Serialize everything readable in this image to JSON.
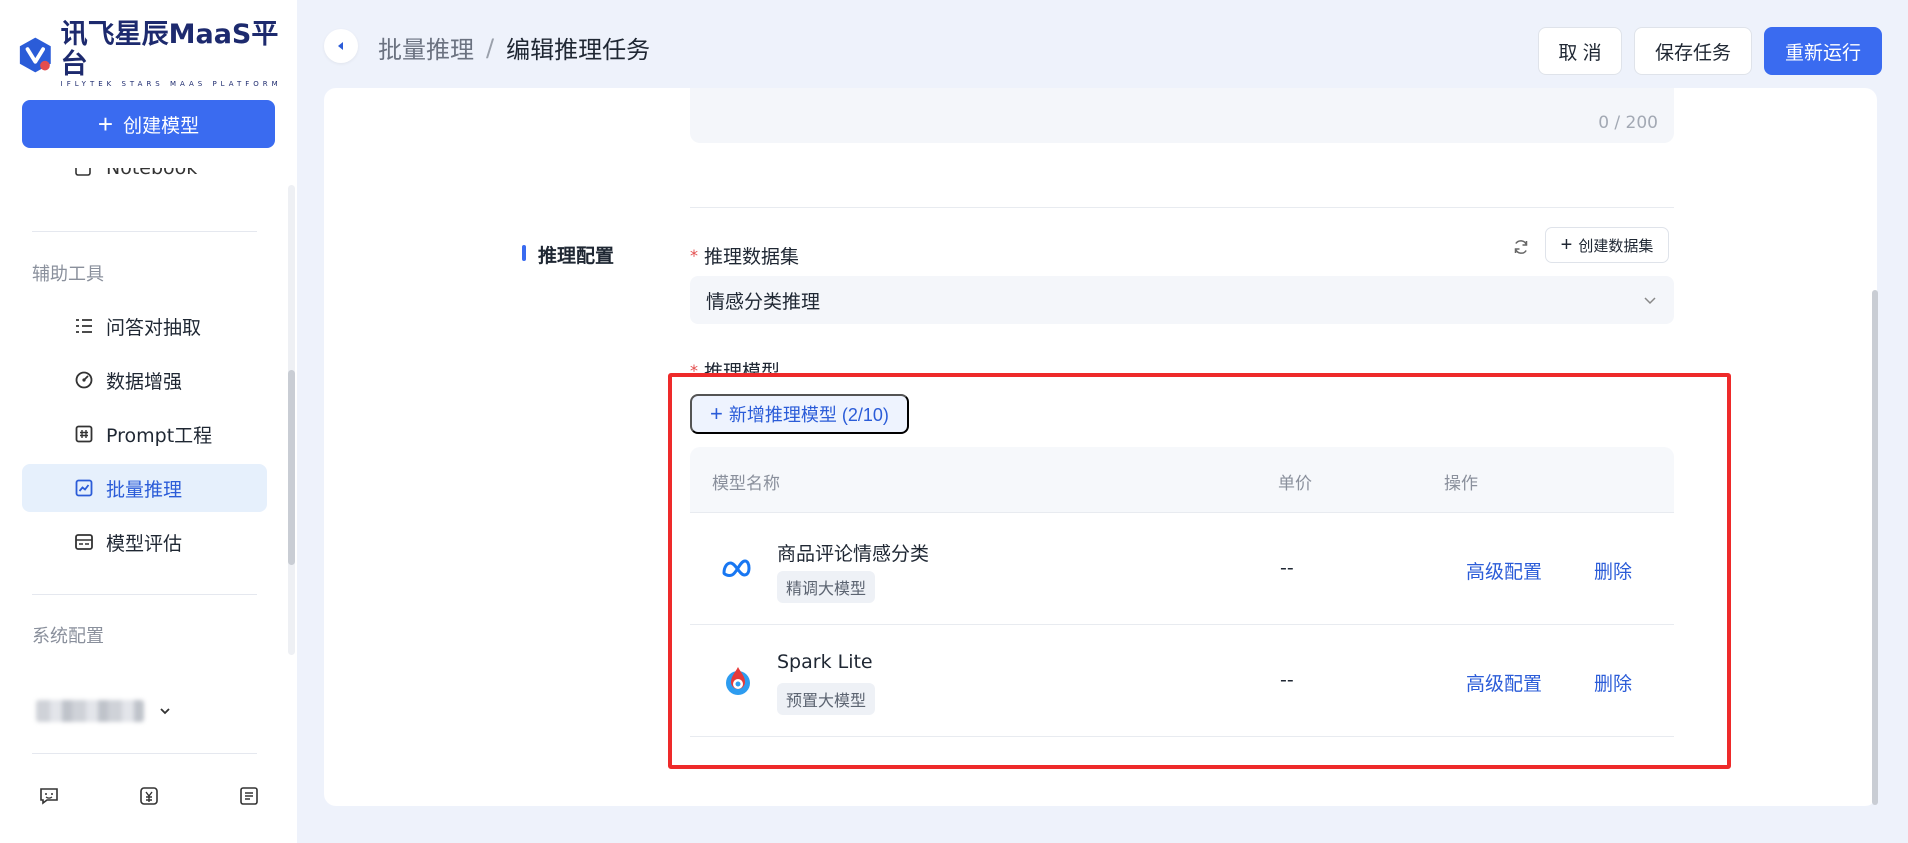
{
  "app": {
    "logo_main": "讯飞星辰MaaS平台",
    "logo_sub": "IFLYTEK STARS MAAS PLATFORM"
  },
  "sidebar": {
    "create_label": "创建模型",
    "clipped_item": "Notebook",
    "groups": [
      {
        "title": "辅助工具"
      },
      {
        "title": "系统配置"
      }
    ],
    "items": [
      {
        "label": "问答对抽取",
        "icon": "list-icon"
      },
      {
        "label": "数据增强",
        "icon": "enhance-icon"
      },
      {
        "label": "Prompt工程",
        "icon": "prompt-icon"
      },
      {
        "label": "批量推理",
        "icon": "chart-icon",
        "active": true
      },
      {
        "label": "模型评估",
        "icon": "evaluate-icon"
      }
    ]
  },
  "header": {
    "breadcrumb_parent": "批量推理",
    "breadcrumb_sep": "/",
    "breadcrumb_current": "编辑推理任务",
    "cancel_label": "取 消",
    "save_label": "保存任务",
    "rerun_label": "重新运行"
  },
  "form": {
    "desc_counter": "0 / 200",
    "section_title": "推理配置",
    "dataset_label": "推理数据集",
    "dataset_value": "情感分类推理",
    "create_dataset_label": "创建数据集",
    "model_label": "推理模型",
    "add_model_label": "新增推理模型 (2/10)"
  },
  "table": {
    "headers": {
      "name": "模型名称",
      "price": "单价",
      "ops": "操作"
    },
    "rows": [
      {
        "name": "商品评论情感分类",
        "tag": "精调大模型",
        "price": "--",
        "op_config": "高级配置",
        "op_delete": "删除",
        "icon": "meta-icon"
      },
      {
        "name": "Spark Lite",
        "tag": "预置大模型",
        "price": "--",
        "op_config": "高级配置",
        "op_delete": "删除",
        "icon": "spark-icon"
      }
    ]
  },
  "colors": {
    "primary": "#3a6bf0",
    "link": "#2b5cd8",
    "highlight": "#ee2a2a",
    "active_bg": "#e6f0fc"
  }
}
